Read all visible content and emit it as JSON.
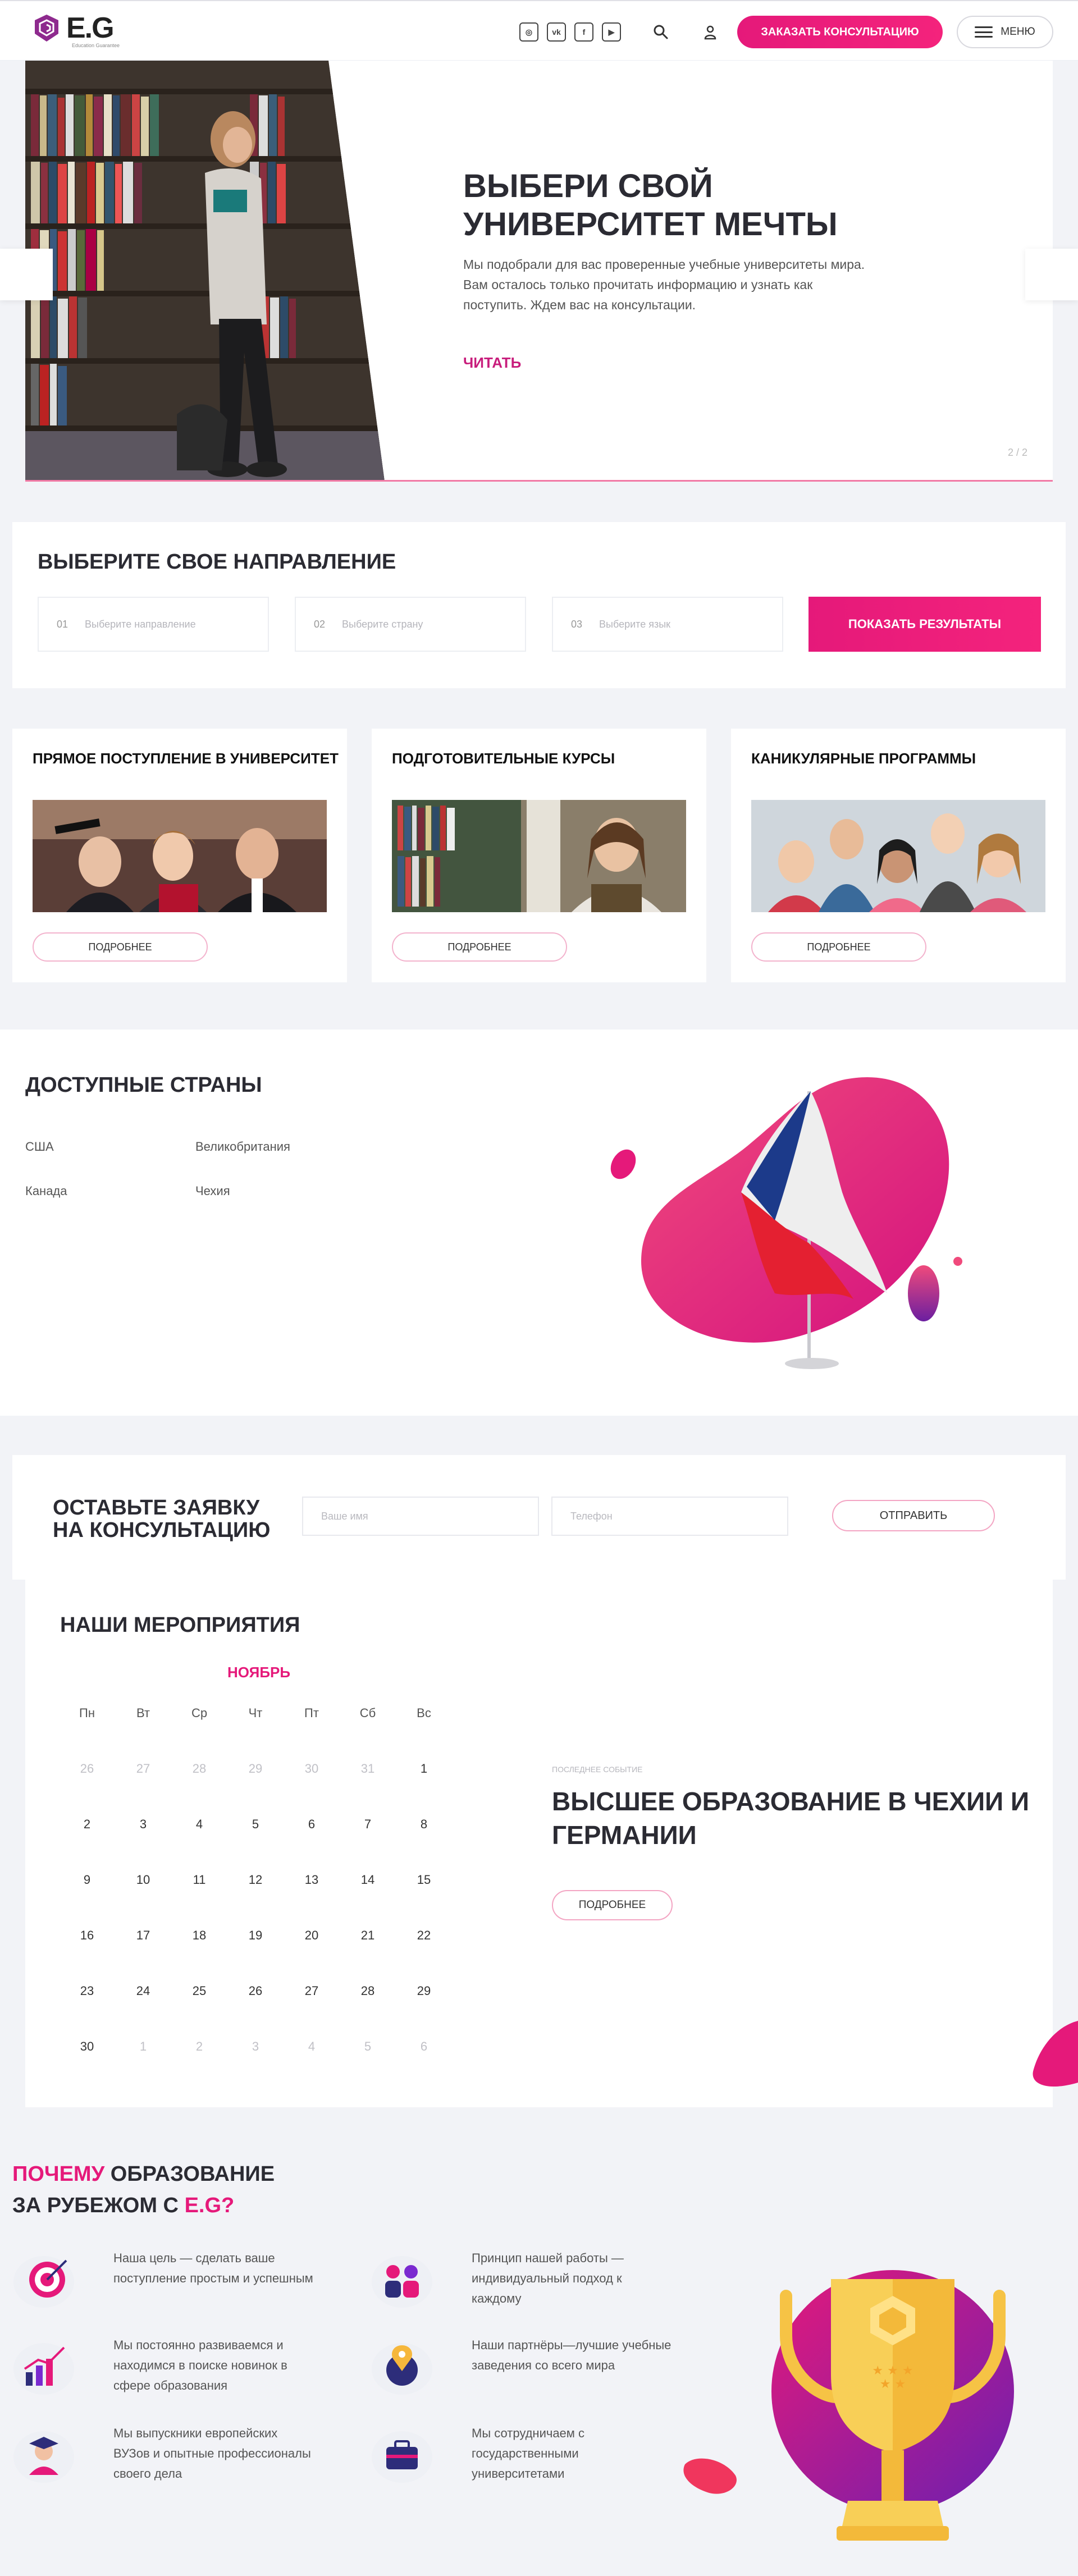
{
  "header": {
    "logo_text": "E.G",
    "logo_sub": "Education Guarantee",
    "socials": [
      {
        "name": "instagram-icon",
        "glyph": "◎"
      },
      {
        "name": "vk-icon",
        "glyph": "vk"
      },
      {
        "name": "facebook-icon",
        "glyph": "f"
      },
      {
        "name": "youtube-icon",
        "glyph": "▶"
      }
    ],
    "cta_label": "ЗАКАЗАТЬ КОНСУЛЬТАЦИЮ",
    "menu_label": "МЕНЮ"
  },
  "hero": {
    "title_line1": "ВЫБЕРИ СВОЙ",
    "title_line2": "УНИВЕРСИТЕТ МЕЧТЫ",
    "text": "Мы подобрали для вас проверенные учебные университеты мира. Вам осталось только прочитать информацию и узнать как поступить. Ждем вас на консультации.",
    "read_label": "ЧИТАТЬ",
    "counter_current": "2",
    "counter_total": "/ 2"
  },
  "direction": {
    "title": "ВЫБЕРИТЕ СВОЕ НАПРАВЛЕНИЕ",
    "fields": [
      {
        "num": "01",
        "placeholder": "Выберите направление"
      },
      {
        "num": "02",
        "placeholder": "Выберите страну"
      },
      {
        "num": "03",
        "placeholder": "Выберите язык"
      }
    ],
    "button": "ПОКАЗАТЬ РЕЗУЛЬТАТЫ"
  },
  "programs": [
    {
      "title": "ПРЯМОЕ ПОСТУПЛЕНИЕ В УНИВЕРСИТЕТ",
      "button": "ПОДРОБНЕЕ"
    },
    {
      "title": "ПОДГОТОВИТЕЛЬНЫЕ КУРСЫ",
      "button": "ПОДРОБНЕЕ"
    },
    {
      "title": "КАНИКУЛЯРНЫЕ ПРОГРАММЫ",
      "button": "ПОДРОБНЕЕ"
    }
  ],
  "countries": {
    "title": "ДОСТУПНЫЕ СТРАНЫ",
    "items": [
      "США",
      "Великобритания",
      "Канада",
      "Чехия"
    ]
  },
  "request": {
    "title_line1": "ОСТАВЬТЕ ЗАЯВКУ",
    "title_line2": "НА КОНСУЛЬТАЦИЮ",
    "name_placeholder": "Ваше имя",
    "phone_placeholder": "Телефон",
    "button": "ОТПРАВИТЬ"
  },
  "events": {
    "title": "НАШИ МЕРОПРИЯТИЯ",
    "month": "НОЯБРЬ",
    "weekdays": [
      "Пн",
      "Вт",
      "Ср",
      "Чт",
      "Пт",
      "Сб",
      "Вс"
    ],
    "weeks": [
      [
        "26",
        "27",
        "28",
        "29",
        "30",
        "31",
        "1"
      ],
      [
        "2",
        "3",
        "4",
        "5",
        "6",
        "7",
        "8"
      ],
      [
        "9",
        "10",
        "11",
        "12",
        "13",
        "14",
        "15"
      ],
      [
        "16",
        "17",
        "18",
        "19",
        "20",
        "21",
        "22"
      ],
      [
        "23",
        "24",
        "25",
        "26",
        "27",
        "28",
        "29"
      ],
      [
        "30",
        "1",
        "2",
        "3",
        "4",
        "5",
        "6"
      ]
    ],
    "last_event_tag": "ПОСЛЕДНЕЕ СОБЫТИЕ",
    "last_event_title": "ВЫСШЕЕ ОБРАЗОВАНИЕ В ЧЕХИИ И ГЕРМАНИИ",
    "button": "ПОДРОБНЕЕ"
  },
  "why": {
    "title_pink1": "ПОЧЕМУ",
    "title_black1": " ОБРАЗОВАНИЕ",
    "title_black2": "ЗА РУБЕЖОМ С ",
    "title_pink2": "E.G?",
    "items": [
      {
        "icon": "target-icon",
        "text": "Наша цель — сделать ваше поступление простым и успешным"
      },
      {
        "icon": "team-icon",
        "text": "Принцип нашей работы — индивидуальный подход к каждому"
      },
      {
        "icon": "growth-chart-icon",
        "text": "Мы постоянно развиваемся и находимся в поиске новинок в сфере образования"
      },
      {
        "icon": "globe-location-icon",
        "text": "Наши партнёры—лучшие учебные заведения со всего мира"
      },
      {
        "icon": "graduate-icon",
        "text": "Мы выпускники европейских ВУЗов и опытные профессионалы своего дела"
      },
      {
        "icon": "briefcase-icon",
        "text": "Мы сотрудничаем с государственными университетами"
      }
    ]
  },
  "colors": {
    "accent": "#e5197a",
    "background": "#f2f3f7",
    "card": "#ffffff"
  }
}
